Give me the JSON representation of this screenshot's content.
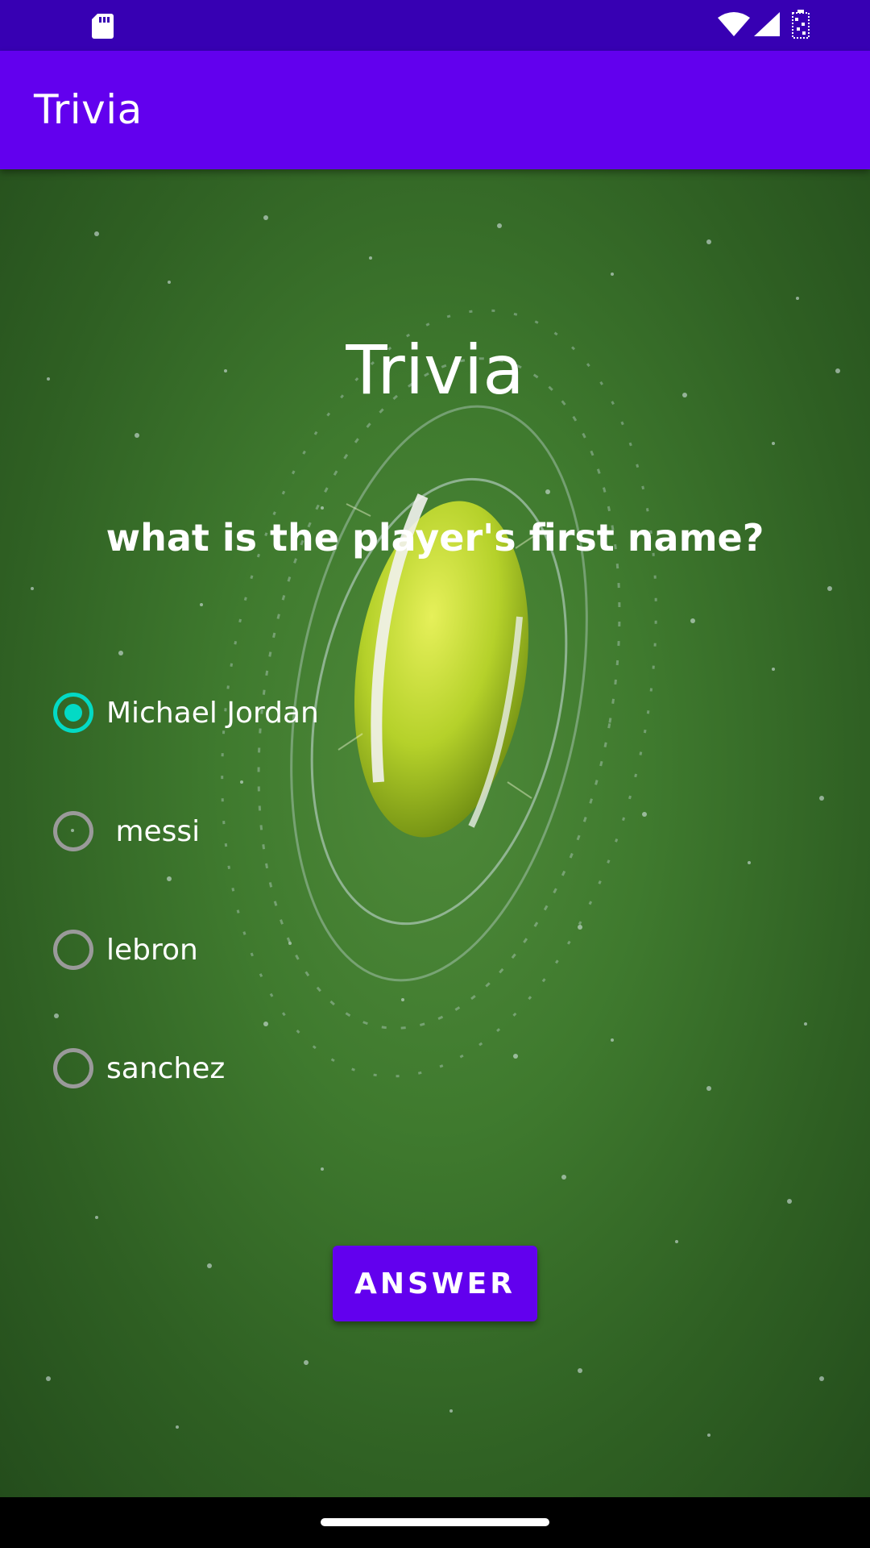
{
  "status_bar": {
    "icons": [
      "sd-card-icon",
      "wifi-icon",
      "signal-icon",
      "battery-icon"
    ],
    "color": "#3700b3"
  },
  "app_bar": {
    "title": "Trivia",
    "color": "#6200ee"
  },
  "main": {
    "heading": "Trivia",
    "question": "what is the player's first name?",
    "background": "tennis-ball-splash-image",
    "options": [
      {
        "label": "Michael Jordan",
        "checked": true
      },
      {
        "label": " messi",
        "checked": false
      },
      {
        "label": "lebron",
        "checked": false
      },
      {
        "label": "sanchez",
        "checked": false
      }
    ],
    "answer_button": "ANSWER",
    "accent_color": "#03dac5"
  },
  "nav_bar": {
    "icons": [
      "home-handle"
    ]
  }
}
